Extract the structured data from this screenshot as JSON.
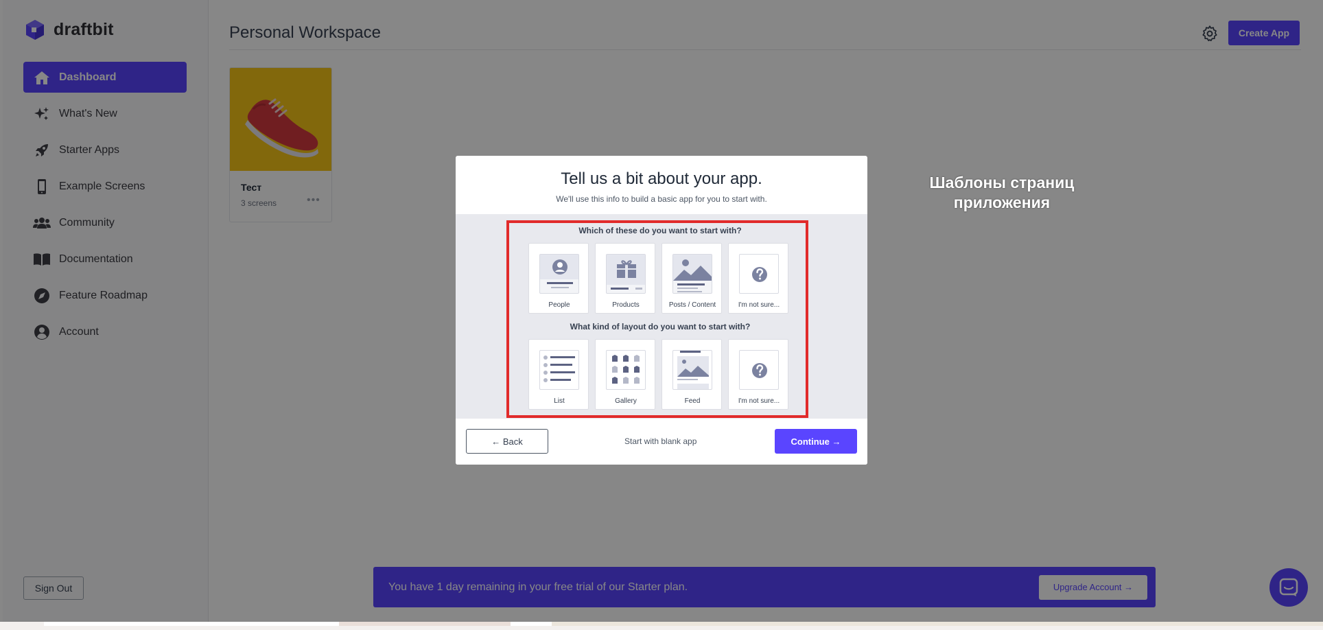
{
  "app": {
    "logo_text": "draftbit"
  },
  "sidebar": {
    "items": [
      {
        "label": "Dashboard",
        "icon": "home-icon",
        "active": true
      },
      {
        "label": "What's New",
        "icon": "sparkles-icon"
      },
      {
        "label": "Starter Apps",
        "icon": "rocket-icon"
      },
      {
        "label": "Example Screens",
        "icon": "phone-icon"
      },
      {
        "label": "Community",
        "icon": "users-icon"
      },
      {
        "label": "Documentation",
        "icon": "book-icon"
      },
      {
        "label": "Feature Roadmap",
        "icon": "compass-icon"
      },
      {
        "label": "Account",
        "icon": "user-circle-icon"
      }
    ],
    "signout_label": "Sign Out"
  },
  "header": {
    "title": "Personal Workspace",
    "create_label": "Create App"
  },
  "apps": [
    {
      "name": "Тест",
      "meta": "3 screens",
      "more": "•••"
    }
  ],
  "trial": {
    "text": "You have 1 day remaining in your free trial of our Starter plan.",
    "upgrade_label": "Upgrade Account →"
  },
  "annotation": {
    "line1": "Шаблоны страниц",
    "line2": "приложения"
  },
  "modal": {
    "title": "Tell us a bit about your app.",
    "subtitle": "We'll use this info to build a basic app for you to start with.",
    "question1": "Which of these do you want to start with?",
    "options1": [
      "People",
      "Products",
      "Posts / Content",
      "I'm not sure..."
    ],
    "question2": "What kind of layout do you want to start with?",
    "options2": [
      "List",
      "Gallery",
      "Feed",
      "I'm not sure..."
    ],
    "back_label": "← Back",
    "blank_label": "Start with blank app",
    "continue_label": "Continue →"
  },
  "colors": {
    "accent": "#5a45ff",
    "highlight": "#e12b2b",
    "thumb_yellow": "#f5c518"
  }
}
